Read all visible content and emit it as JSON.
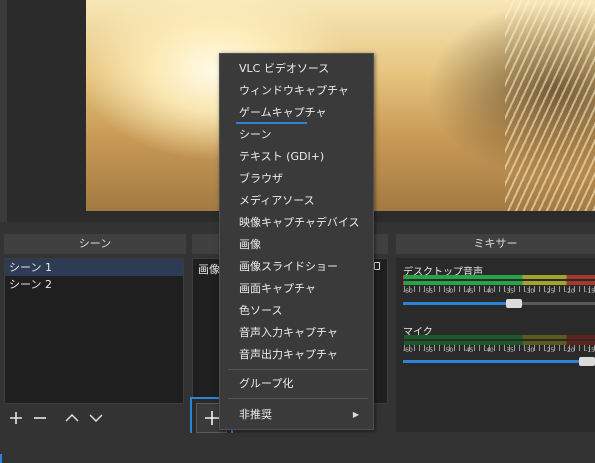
{
  "docks": {
    "scenes_title": "シーン",
    "mixer_title": "ミキサー"
  },
  "scenes": [
    "シーン 1",
    "シーン 2"
  ],
  "sources": {
    "partial_item": "画像"
  },
  "scene_toolbar": {
    "add": "+",
    "remove": "−",
    "up": "∧",
    "down": "∨"
  },
  "add_source_glyph": "+",
  "mixer": {
    "channels": [
      {
        "name": "デスクトップ音声",
        "volume": 0.58
      },
      {
        "name": "マイク",
        "volume": 1.0
      }
    ],
    "scale": [
      "-60",
      "-55",
      "-50",
      "-45",
      "-40",
      "-35",
      "-30",
      "-25",
      "-20",
      "-15"
    ]
  },
  "menu": {
    "items": [
      "VLC ビデオソース",
      "ウィンドウキャプチャ",
      "ゲームキャプチャ",
      "シーン",
      "テキスト (GDI+)",
      "ブラウザ",
      "メディアソース",
      "映像キャプチャデバイス",
      "画像",
      "画像スライドショー",
      "画面キャプチャ",
      "色ソース",
      "音声入力キャプチャ",
      "音声出力キャプチャ"
    ],
    "group": "グループ化",
    "deprecated": "非推奨",
    "submenu_arrow": "▶"
  },
  "colors": {
    "accent": "#2c84d8",
    "meter_green": "#29a347"
  }
}
